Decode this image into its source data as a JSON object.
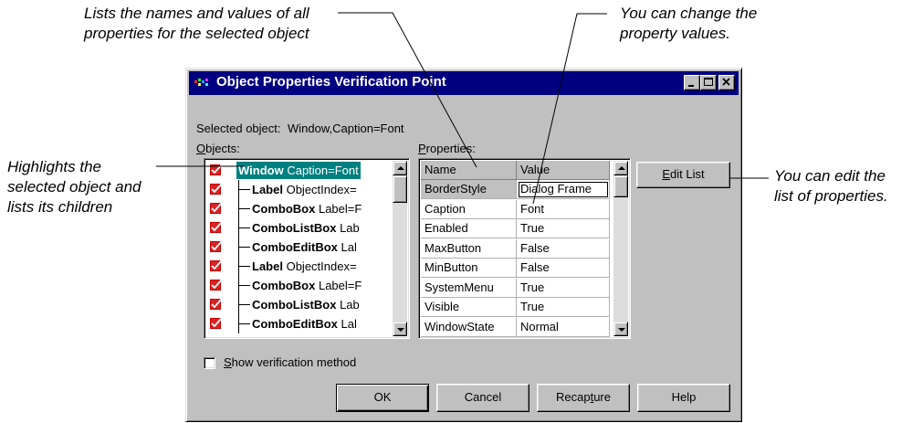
{
  "callouts": {
    "top_left": [
      "Lists the names and values of all",
      "properties for the selected object"
    ],
    "top_right": [
      "You can change the",
      "property values."
    ],
    "left": [
      "Highlights the",
      "selected object and",
      "lists its children"
    ],
    "right": [
      "You can edit the",
      "list of properties."
    ]
  },
  "dialog": {
    "title": "Object Properties Verification Point",
    "selected_object_label": "Selected object:",
    "selected_object_value": "Window,Caption=Font",
    "objects_label": "Objects:",
    "properties_label": "Properties:",
    "objects": [
      {
        "type": "Window",
        "detail": "Caption=Font",
        "selected": true
      },
      {
        "type": "Label",
        "detail": "ObjectIndex=",
        "selected": false
      },
      {
        "type": "ComboBox",
        "detail": "Label=F",
        "selected": false
      },
      {
        "type": "ComboListBox",
        "detail": "Lab",
        "selected": false
      },
      {
        "type": "ComboEditBox",
        "detail": "Lal",
        "selected": false
      },
      {
        "type": "Label",
        "detail": "ObjectIndex=",
        "selected": false
      },
      {
        "type": "ComboBox",
        "detail": "Label=F",
        "selected": false
      },
      {
        "type": "ComboListBox",
        "detail": "Lab",
        "selected": false
      },
      {
        "type": "ComboEditBox",
        "detail": "Lal",
        "selected": false
      }
    ],
    "properties_columns": [
      "Name",
      "Value"
    ],
    "properties": [
      {
        "name": "BorderStyle",
        "value": "Dialog Frame"
      },
      {
        "name": "Caption",
        "value": "Font"
      },
      {
        "name": "Enabled",
        "value": "True"
      },
      {
        "name": "MaxButton",
        "value": "False"
      },
      {
        "name": "MinButton",
        "value": "False"
      },
      {
        "name": "SystemMenu",
        "value": "True"
      },
      {
        "name": "Visible",
        "value": "True"
      },
      {
        "name": "WindowState",
        "value": "Normal"
      }
    ],
    "edit_list_label": "Edit List",
    "show_verification_label": "Show verification method",
    "show_verification_checked": false,
    "buttons": {
      "ok": "OK",
      "cancel": "Cancel",
      "recapture": "Recapture",
      "help": "Help"
    }
  },
  "colors": {
    "titlebar": "#000080",
    "selection": "#008080",
    "check": "#cc0000"
  }
}
